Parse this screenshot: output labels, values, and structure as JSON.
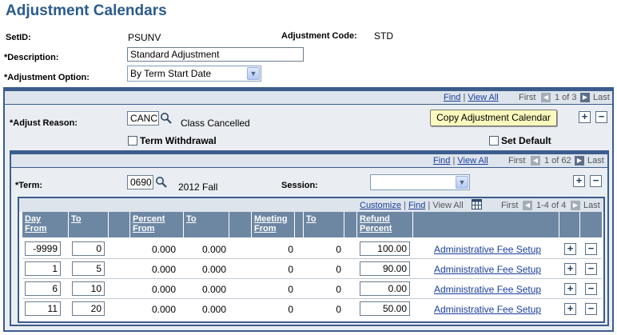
{
  "page_title": "Adjustment Calendars",
  "header": {
    "setid_label": "SetID:",
    "setid_value": "PSUNV",
    "adj_code_label": "Adjustment Code:",
    "adj_code_value": "STD",
    "description_label": "*Description:",
    "description_value": "Standard Adjustment",
    "option_label": "*Adjustment Option:",
    "option_value": "By Term Start Date"
  },
  "outer_nav": {
    "find": "Find",
    "view_all": "View All",
    "sep": "|",
    "first": "First",
    "range": "1 of 3",
    "last": "Last"
  },
  "reason": {
    "label": "*Adjust Reason:",
    "code": "CANC",
    "desc": "Class Cancelled",
    "copy_button": "Copy Adjustment Calendar",
    "term_withdrawal": "Term Withdrawal",
    "set_default": "Set Default"
  },
  "term_nav": {
    "find": "Find",
    "view_all": "View All",
    "sep": "|",
    "first": "First",
    "range": "1 of 62",
    "last": "Last"
  },
  "term": {
    "label": "*Term:",
    "code": "0690",
    "desc": "2012 Fall",
    "session_label": "Session:",
    "session_value": ""
  },
  "grid_nav": {
    "customize": "Customize",
    "find": "Find",
    "view_all": "View All",
    "sep": "|",
    "first": "First",
    "range": "1-4 of 4",
    "last": "Last"
  },
  "columns": {
    "day_from_1": "Day",
    "day_from_2": "From",
    "to_1": "To",
    "pct_from_1": "Percent",
    "pct_from_2": "From",
    "to_2": "To",
    "meet_from_1": "Meeting",
    "meet_from_2": "From",
    "to_3": "To",
    "refund_1": "Refund",
    "refund_2": "Percent"
  },
  "rows": [
    {
      "day_from": "-9999",
      "day_to": "0",
      "pct_from": "0.000",
      "pct_to": "0.000",
      "meet_from": "0",
      "meet_to": "0",
      "refund": "100.00",
      "link": "Administrative Fee Setup"
    },
    {
      "day_from": "1",
      "day_to": "5",
      "pct_from": "0.000",
      "pct_to": "0.000",
      "meet_from": "0",
      "meet_to": "0",
      "refund": "90.00",
      "link": "Administrative Fee Setup"
    },
    {
      "day_from": "6",
      "day_to": "10",
      "pct_from": "0.000",
      "pct_to": "0.000",
      "meet_from": "0",
      "meet_to": "0",
      "refund": "0.00",
      "link": "Administrative Fee Setup"
    },
    {
      "day_from": "11",
      "day_to": "20",
      "pct_from": "0.000",
      "pct_to": "0.000",
      "meet_from": "0",
      "meet_to": "0",
      "refund": "50.00",
      "link": "Administrative Fee Setup"
    }
  ],
  "icons": {
    "plus": "+",
    "minus": "−",
    "prev": "◀",
    "next": "▶",
    "dropdown": "▼"
  }
}
